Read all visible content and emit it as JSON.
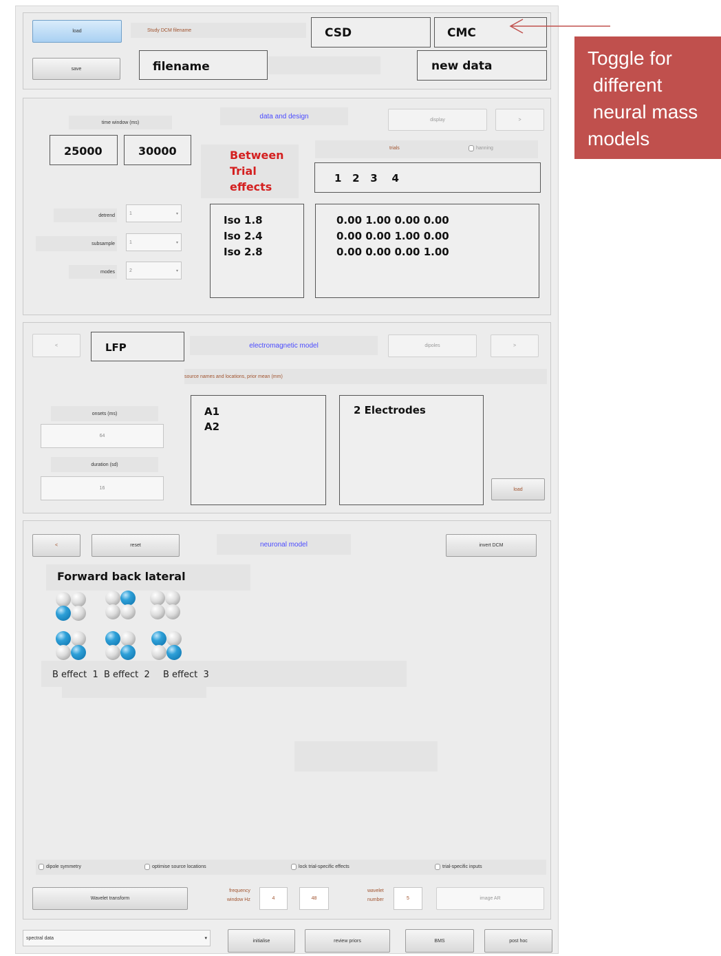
{
  "top": {
    "load_label": "load",
    "save_label": "save",
    "study_label": "Study DCM filename",
    "filename": "filename",
    "csd_label": "CSD",
    "cmc_label": "CMC",
    "new_data_label": "new data"
  },
  "annotation": {
    "lines": [
      "Toggle for",
      " different",
      " neural mass",
      "models"
    ]
  },
  "data_design": {
    "time_window_label": "time window (ms)",
    "time_start": "25000",
    "time_end": "30000",
    "title": "data and design",
    "display_label": "display",
    "next_label": ">",
    "between_trial_label_1": "Between",
    "between_trial_label_2": "Trial",
    "between_trial_label_3": "effects",
    "trials_label": "trials",
    "hanning_label": "hanning",
    "trials_value": "1   2   3    4",
    "detrend_label": "detrend",
    "detrend_value": "1",
    "subsample_label": "subsample",
    "subsample_value": "1",
    "modes_label": "modes",
    "modes_value": "2",
    "effect_names": [
      "Iso 1.8",
      "Iso 2.4",
      "Iso 2.8"
    ],
    "effect_matrix": [
      "0.00 1.00 0.00 0.00",
      "0.00 0.00 1.00 0.00",
      "0.00 0.00 0.00 1.00"
    ]
  },
  "em_model": {
    "prev_label": "<",
    "model_type": "LFP",
    "title": "electromagnetic model",
    "dipoles_label": "dipoles",
    "next_label": ">",
    "source_names_label": "source names and locations, prior mean (mm)",
    "onsets_label": "onsets (ms)",
    "onsets_value": "64",
    "duration_label": "duration (sd)",
    "duration_value": "16",
    "sources": [
      "A1",
      "A2"
    ],
    "electrodes": "2 Electrodes",
    "load_label": "load"
  },
  "neuronal": {
    "prev_label": "<",
    "reset_label": "reset",
    "title": "neuronal model",
    "invert_label": "invert DCM",
    "connections_title": "Forward back lateral",
    "effect_labels": [
      "B effect  1",
      "B effect  2",
      "B effect  3"
    ]
  },
  "options": {
    "dipole_symmetry": "dipole symmetry",
    "optimise_source": "optimise source locations",
    "lock_trial": "lock trial-specific effects",
    "trial_inputs": "trial-specific inputs",
    "wavelet_label": "Wavelet transform",
    "freq_label_1": "frequency",
    "freq_label_2": "window Hz",
    "freq_low": "4",
    "freq_high": "48",
    "wavelet_num_label_1": "wavelet",
    "wavelet_num_label_2": "number",
    "wavelet_num": "5",
    "image_ar_label": "image AR"
  },
  "bottom": {
    "spectral_select": "spectral data",
    "initialise": "initialise",
    "review": "review priors",
    "bms": "BMS",
    "posthoc": "post hoc"
  }
}
